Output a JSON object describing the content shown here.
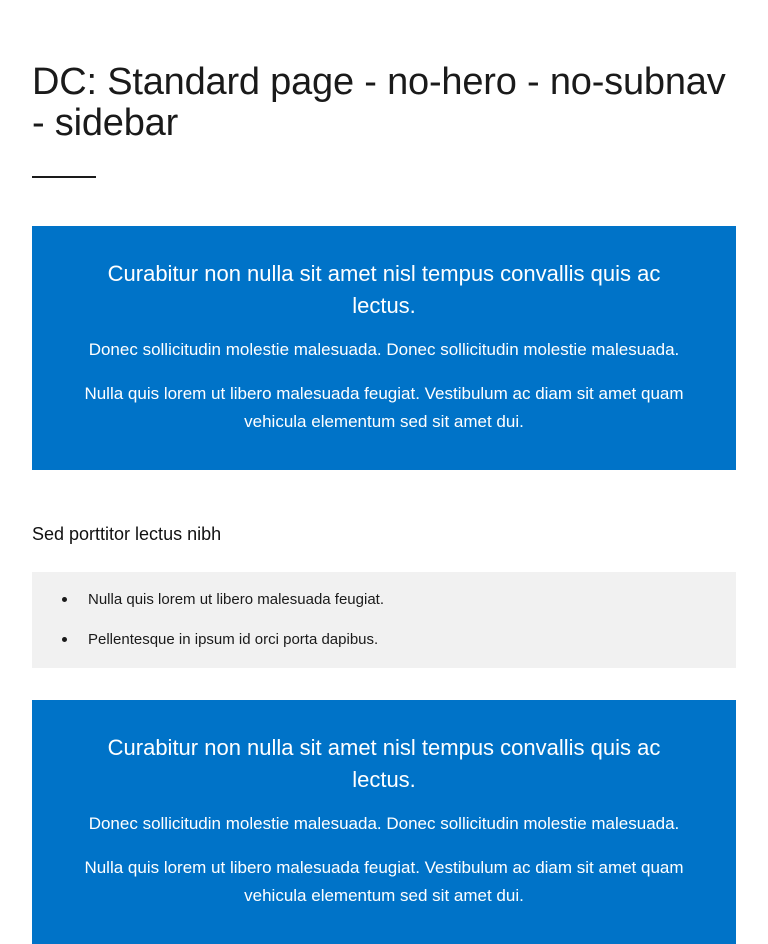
{
  "page": {
    "title": "DC: Standard page - no-hero - no-subnav - sidebar"
  },
  "callout_1": {
    "heading": "Curabitur non nulla sit amet nisl tempus convallis quis ac lectus.",
    "paragraph_1": "Donec sollicitudin molestie malesuada. Donec sollicitudin molestie malesuada.",
    "paragraph_2": "Nulla quis lorem ut libero malesuada feugiat. Vestibulum ac diam sit amet quam vehicula elementum sed sit amet dui."
  },
  "section": {
    "heading": "Sed porttitor lectus nibh",
    "list": [
      "Nulla quis lorem ut libero malesuada feugiat.",
      "Pellentesque in ipsum id orci porta dapibus."
    ]
  },
  "callout_2": {
    "heading": "Curabitur non nulla sit amet nisl tempus convallis quis ac lectus.",
    "paragraph_1": "Donec sollicitudin molestie malesuada. Donec sollicitudin molestie malesuada.",
    "paragraph_2": "Nulla quis lorem ut libero malesuada feugiat. Vestibulum ac diam sit amet quam vehicula elementum sed sit amet dui."
  },
  "colors": {
    "callout_background": "#0073c8",
    "list_background": "#f1f1f1",
    "text": "#1a1a1a"
  }
}
